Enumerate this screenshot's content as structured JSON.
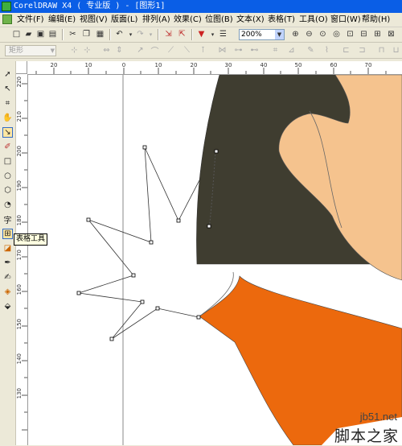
{
  "window": {
    "title": "CorelDRAW X4 ( 专业版 ) - [图形1]"
  },
  "menu": {
    "items": [
      "文件(F)",
      "编辑(E)",
      "视图(V)",
      "版面(L)",
      "排列(A)",
      "效果(C)",
      "位图(B)",
      "文本(X)",
      "表格(T)",
      "工具(O)",
      "窗口(W)",
      "帮助(H)"
    ]
  },
  "toolbar": {
    "zoom_value": "200%",
    "shape_select_value": "矩形",
    "icons": [
      "new-icon",
      "open-icon",
      "save-icon",
      "print-icon",
      "cut-icon",
      "copy-icon",
      "paste-icon",
      "undo-icon",
      "redo-icon",
      "import-icon",
      "export-icon",
      "application-launcher-icon",
      "welcome-screen-icon",
      "zoom-in-icon",
      "zoom-out-icon",
      "zoom-selected-icon",
      "zoom-all-icon",
      "zoom-page-icon",
      "zoom-width-icon",
      "zoom-height-icon"
    ]
  },
  "ruler": {
    "horizontal": [
      "20",
      "10",
      "0",
      "10",
      "20",
      "30",
      "40",
      "50",
      "60",
      "70"
    ],
    "vertical": [
      "220",
      "210",
      "200",
      "190",
      "180",
      "170",
      "160",
      "150",
      "140",
      "130"
    ]
  },
  "toolbox": {
    "tools": [
      "pick-tool-icon",
      "shape-tool-icon",
      "crop-tool-icon",
      "zoom-tool-icon",
      "curve-tool-icon",
      "smart-fill-tool-icon",
      "rectangle-tool-icon",
      "ellipse-tool-icon",
      "polygon-tool-icon",
      "basic-shapes-tool-icon",
      "text-tool-icon",
      "table-tool-icon",
      "interactive-blend-tool-icon",
      "eyedropper-tool-icon",
      "outline-tool-icon",
      "fill-tool-icon",
      "interactive-fill-tool-icon"
    ],
    "active_tool": "table-tool-icon",
    "tooltip": "表格工具"
  },
  "colors": {
    "hair": "#3f3d30",
    "skin": "#f5c38e",
    "shirt": "#ec690d",
    "title_bar": "#0a5ee6"
  },
  "watermark": {
    "site": "jb51.net",
    "text": "脚本之家"
  }
}
